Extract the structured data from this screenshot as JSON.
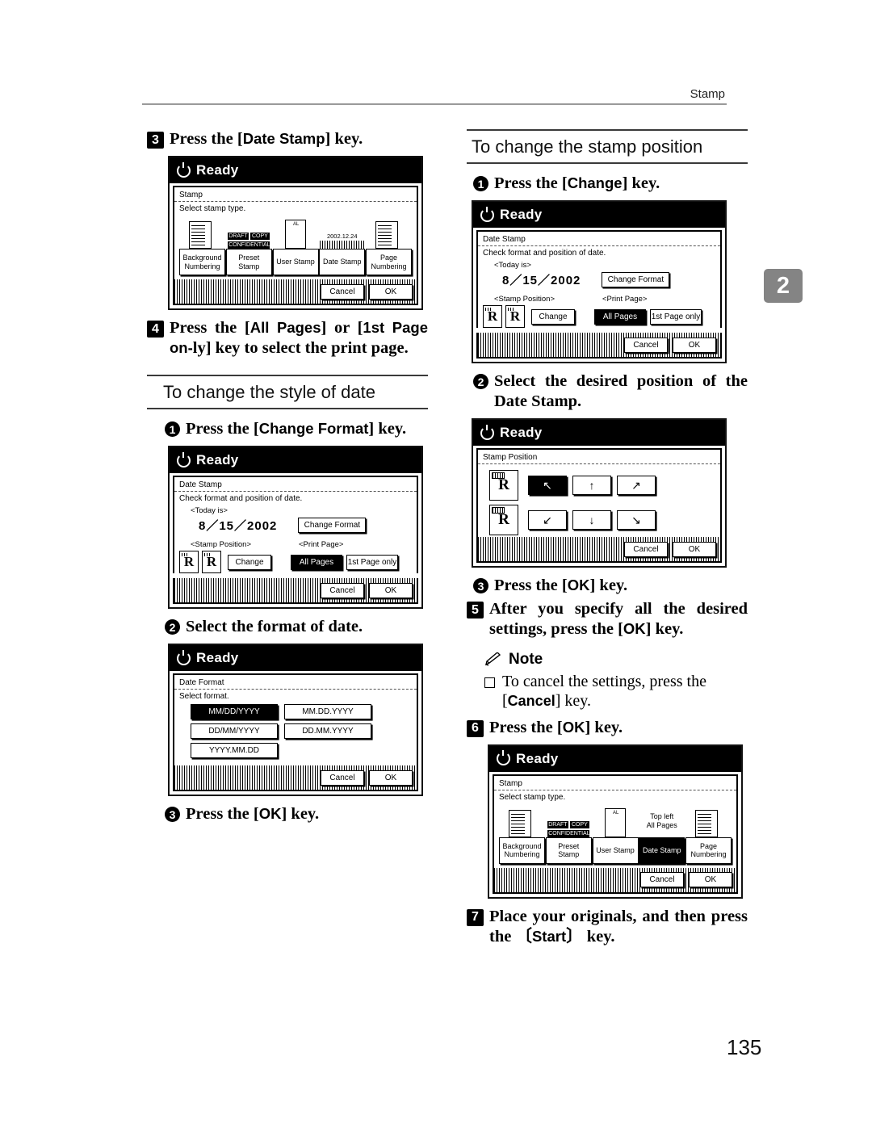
{
  "header": {
    "running_head": "Stamp",
    "chapter_tab": "2",
    "page_number": "135"
  },
  "left_column": {
    "step3": {
      "num": "3",
      "text_before": "Press the [",
      "key": "Date Stamp",
      "text_after": "] key."
    },
    "panel_stamp": {
      "status": "Ready",
      "screen_title": "Stamp",
      "instruction": "Select stamp type.",
      "types": [
        {
          "label_line1": "Background",
          "label_line2": "Numbering",
          "selected": false
        },
        {
          "label_line1": "Preset",
          "label_line2": "Stamp",
          "selected": false
        },
        {
          "label_line1": "User Stamp",
          "label_line2": "",
          "selected": false
        },
        {
          "label_line1": "Date Stamp",
          "label_line2": "",
          "selected": false
        },
        {
          "label_line1": "Page",
          "label_line2": "Numbering",
          "selected": false
        }
      ],
      "icon_texts": {
        "draft": "DRAFT",
        "copy": "COPY",
        "confidential": "CONFIDENTIAL",
        "date_sample": "2002.12.24",
        "user_mark": "AL"
      },
      "cancel": "Cancel",
      "ok": "OK"
    },
    "step4": {
      "num": "4",
      "p1": "Press the [",
      "k1": "All Pages",
      "p2": "] or [",
      "k2": "1st Page on-",
      "p3": "ly] key to select the print page."
    },
    "section_style": "To change the style of date",
    "sub1": {
      "num": "1",
      "p1": "Press the [",
      "k1": "Change Format",
      "p2": "] key."
    },
    "panel_datestamp": {
      "status": "Ready",
      "screen_title": "Date Stamp",
      "instruction": "Check format and position of date.",
      "today_label": "<Today is>",
      "today_value": "8／15／2002",
      "change_format_btn": "Change Format",
      "stamp_position_label": "<Stamp Position>",
      "print_page_label": "<Print Page>",
      "change_btn": "Change",
      "all_pages_btn": "All Pages",
      "first_page_btn": "1st Page only",
      "cancel": "Cancel",
      "ok": "OK"
    },
    "sub2": {
      "num": "2",
      "text": "Select the format of date."
    },
    "panel_dateformat": {
      "status": "Ready",
      "screen_title": "Date Format",
      "instruction": "Select format.",
      "formats": [
        {
          "label": "MM/DD/YYYY",
          "selected": true
        },
        {
          "label": "MM.DD.YYYY",
          "selected": false
        },
        {
          "label": "DD/MM/YYYY",
          "selected": false
        },
        {
          "label": "DD.MM.YYYY",
          "selected": false
        },
        {
          "label": "YYYY.MM.DD",
          "selected": false
        }
      ],
      "cancel": "Cancel",
      "ok": "OK"
    },
    "sub3": {
      "num": "3",
      "p1": "Press the [",
      "k1": "OK",
      "p2": "] key."
    }
  },
  "right_column": {
    "section_position": "To change the stamp position",
    "sub1": {
      "num": "1",
      "p1": "Press the [",
      "k1": "Change",
      "p2": "] key."
    },
    "panel_datestamp2": {
      "status": "Ready",
      "screen_title": "Date Stamp",
      "instruction": "Check format and position of date.",
      "today_label": "<Today is>",
      "today_value": "8／15／2002",
      "change_format_btn": "Change Format",
      "stamp_position_label": "<Stamp Position>",
      "print_page_label": "<Print Page>",
      "change_btn": "Change",
      "all_pages_btn": "All Pages",
      "first_page_btn": "1st Page only",
      "cancel": "Cancel",
      "ok": "OK"
    },
    "sub2": {
      "num": "2",
      "text": "Select the desired position of the Date Stamp."
    },
    "panel_position": {
      "status": "Ready",
      "screen_title": "Stamp Position",
      "arrows_top": [
        "↖",
        "↑",
        "↗"
      ],
      "arrows_bottom": [
        "↙",
        "↓",
        "↘"
      ],
      "selected_arrow_index": 0,
      "cancel": "Cancel",
      "ok": "OK"
    },
    "sub3": {
      "num": "3",
      "p1": "Press the [",
      "k1": "OK",
      "p2": "] key."
    },
    "step5": {
      "num": "5",
      "p1": "After you specify all the desired settings, press the [",
      "k1": "OK",
      "p2": "] key."
    },
    "note": {
      "title": "Note",
      "item_p1": "To cancel the settings, press the [",
      "item_k1": "Cancel",
      "item_p2": "] key."
    },
    "step6": {
      "num": "6",
      "p1": "Press the [",
      "k1": "OK",
      "p2": "] key."
    },
    "panel_stamp2": {
      "status": "Ready",
      "screen_title": "Stamp",
      "instruction": "Select stamp type.",
      "date_stamp_top_label_l1": "Top left",
      "date_stamp_top_label_l2": "All Pages",
      "types": [
        {
          "label_line1": "Background",
          "label_line2": "Numbering",
          "selected": false
        },
        {
          "label_line1": "Preset",
          "label_line2": "Stamp",
          "selected": false
        },
        {
          "label_line1": "User Stamp",
          "label_line2": "",
          "selected": false
        },
        {
          "label_line1": "Date Stamp",
          "label_line2": "",
          "selected": true
        },
        {
          "label_line1": "Page",
          "label_line2": "Numbering",
          "selected": false
        }
      ],
      "icon_texts": {
        "draft": "DRAFT",
        "copy": "COPY",
        "confidential": "CONFIDENTIAL",
        "user_mark": "AL"
      },
      "cancel": "Cancel",
      "ok": "OK"
    },
    "step7": {
      "num": "7",
      "p1": "Place your originals, and then press the 〔",
      "k1": "Start",
      "p2": "〕 key."
    }
  }
}
